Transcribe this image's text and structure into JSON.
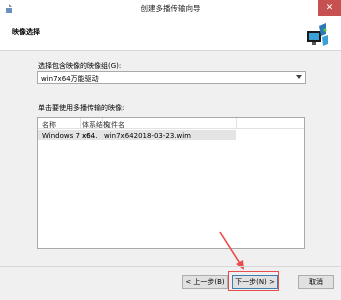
{
  "window": {
    "title": "创建多播传输向导",
    "close": "✕"
  },
  "header": {
    "title": "映像选择"
  },
  "group": {
    "label": "选择包含映像的映像组(G):",
    "value": "win7x64万能驱动"
  },
  "images": {
    "label": "单击要使用多播传输的映像:",
    "columns": [
      "名称",
      "体系结构",
      "文件名"
    ],
    "rows": [
      {
        "name": "Windows 7 x6...",
        "arch": "x64",
        "file": "win7x642018-03-23.wim"
      }
    ]
  },
  "buttons": {
    "back": "< 上一步(B)",
    "next": "下一步(N) >",
    "cancel": "取消"
  },
  "accent_colors": {
    "annotation": "#e84c4c",
    "close": "#c75050"
  }
}
